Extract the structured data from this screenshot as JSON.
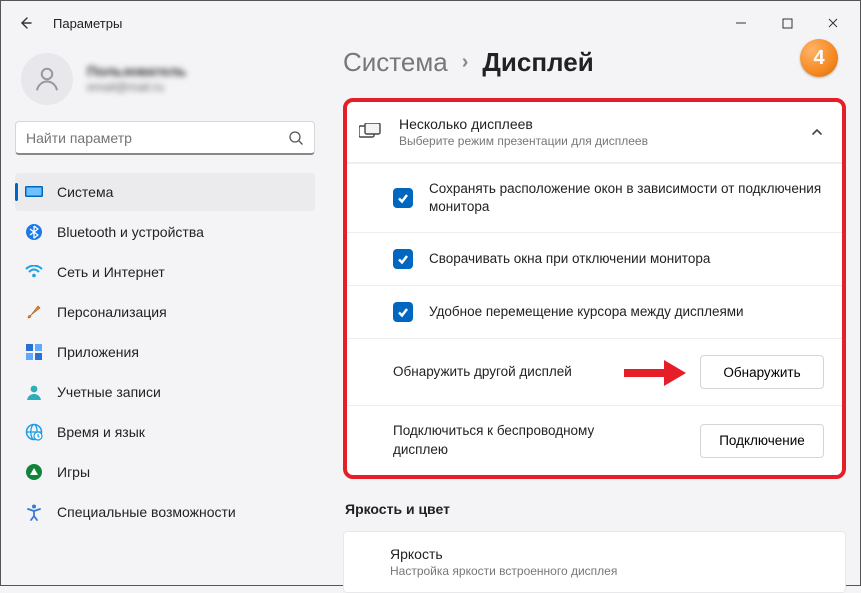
{
  "window": {
    "title": "Параметры"
  },
  "account": {
    "name": "Пользователь",
    "email": "email@mail.ru"
  },
  "search": {
    "placeholder": "Найти параметр"
  },
  "sidebar": {
    "items": [
      {
        "label": "Система"
      },
      {
        "label": "Bluetooth и устройства"
      },
      {
        "label": "Сеть и Интернет"
      },
      {
        "label": "Персонализация"
      },
      {
        "label": "Приложения"
      },
      {
        "label": "Учетные записи"
      },
      {
        "label": "Время и язык"
      },
      {
        "label": "Игры"
      },
      {
        "label": "Специальные возможности"
      }
    ]
  },
  "breadcrumb": {
    "root": "Система",
    "leaf": "Дисплей"
  },
  "panel": {
    "title": "Несколько дисплеев",
    "subtitle": "Выберите режим презентации для дисплеев",
    "rows": [
      {
        "label": "Сохранять расположение окон в зависимости от подключения монитора"
      },
      {
        "label": "Сворачивать окна при отключении монитора"
      },
      {
        "label": "Удобное перемещение курсора между дисплеями"
      }
    ],
    "detect": {
      "label": "Обнаружить другой дисплей",
      "button": "Обнаружить"
    },
    "wireless": {
      "label": "Подключиться к беспроводному дисплею",
      "button": "Подключение"
    }
  },
  "section": {
    "title": "Яркость и цвет",
    "brightness": {
      "title": "Яркость",
      "subtitle": "Настройка яркости встроенного дисплея"
    }
  },
  "annotation": {
    "step": "4"
  }
}
